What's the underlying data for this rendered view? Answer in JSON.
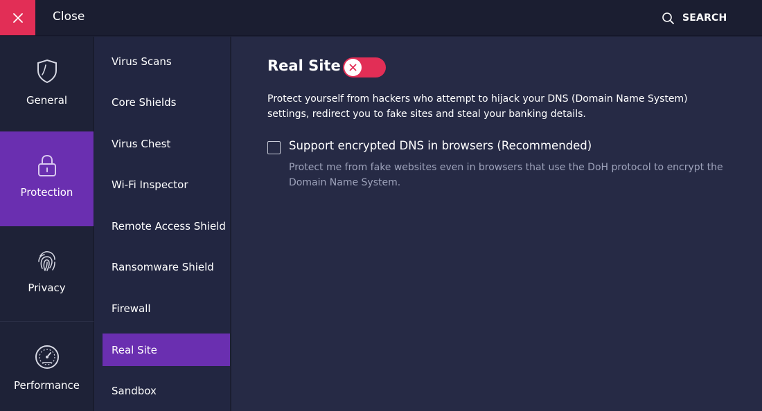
{
  "topbar": {
    "close_label": "Close",
    "search_label": "SEARCH"
  },
  "categories": [
    {
      "label": "General",
      "icon": "shield-icon"
    },
    {
      "label": "Protection",
      "icon": "lock-icon",
      "active": true
    },
    {
      "label": "Privacy",
      "icon": "fingerprint-icon"
    },
    {
      "label": "Performance",
      "icon": "speedometer-icon"
    }
  ],
  "sub_items": [
    {
      "label": "Virus Scans"
    },
    {
      "label": "Core Shields"
    },
    {
      "label": "Virus Chest"
    },
    {
      "label": "Wi-Fi Inspector"
    },
    {
      "label": "Remote Access Shield"
    },
    {
      "label": "Ransomware Shield"
    },
    {
      "label": "Firewall"
    },
    {
      "label": "Real Site",
      "active": true
    },
    {
      "label": "Sandbox"
    }
  ],
  "main": {
    "title": "Real Site",
    "toggle_on": false,
    "description": "Protect yourself from hackers who attempt to hijack your DNS (Domain Name System) settings, redirect you to fake sites and steal your banking details.",
    "option": {
      "label": "Support encrypted DNS in browsers (Recommended)",
      "checked": false,
      "description": "Protect me from fake websites even in browsers that use the DoH protocol to encrypt the Domain Name System."
    }
  },
  "colors": {
    "accent_red": "#e22e56",
    "active_purple": "#6a2fb0",
    "background": "#262a45"
  }
}
